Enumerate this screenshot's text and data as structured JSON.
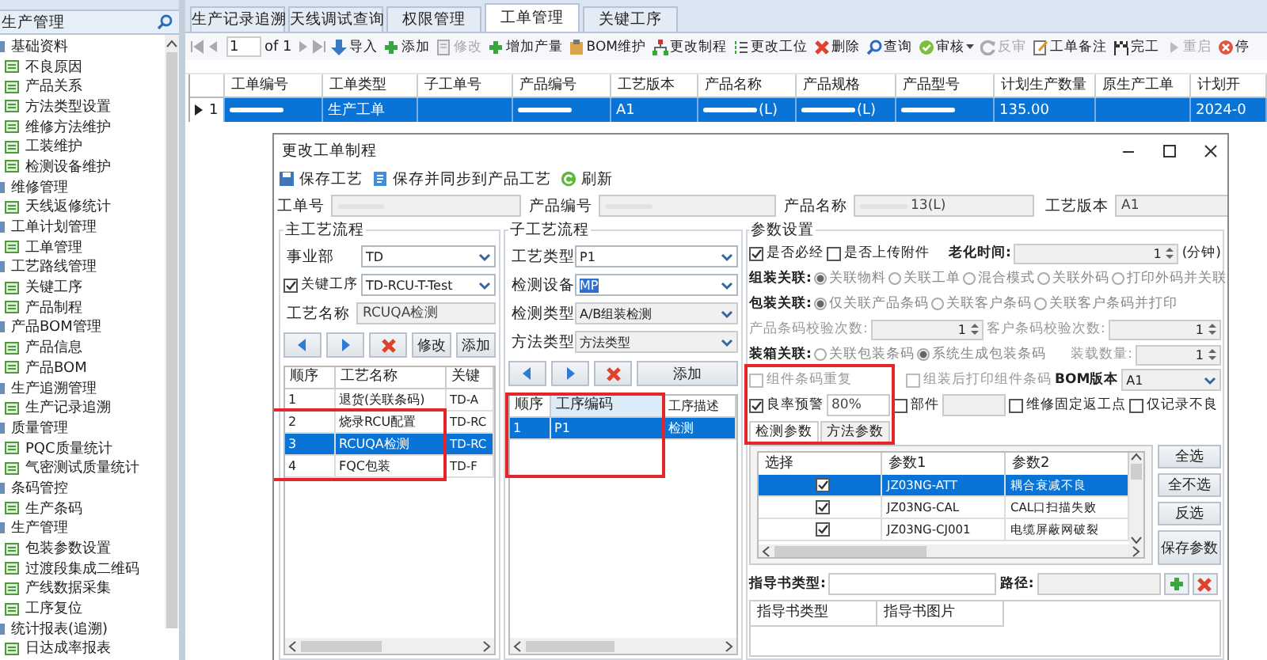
{
  "sidebar": {
    "title": "生产管理",
    "items": [
      {
        "label": "基础资料",
        "children": [
          {
            "label": "不良原因"
          },
          {
            "label": "产品关系"
          },
          {
            "label": "方法类型设置"
          },
          {
            "label": "维修方法维护"
          },
          {
            "label": "工装维护"
          },
          {
            "label": "检测设备维护"
          }
        ]
      },
      {
        "label": "维修管理",
        "children": [
          {
            "label": "天线返修统计"
          }
        ]
      },
      {
        "label": "工单计划管理",
        "children": [
          {
            "label": "工单管理"
          }
        ]
      },
      {
        "label": "工艺路线管理",
        "children": [
          {
            "label": "关键工序"
          },
          {
            "label": "产品制程"
          }
        ]
      },
      {
        "label": "产品BOM管理",
        "children": [
          {
            "label": "产品信息"
          },
          {
            "label": "产品BOM"
          }
        ]
      },
      {
        "label": "生产追溯管理",
        "children": [
          {
            "label": "生产记录追溯"
          }
        ]
      },
      {
        "label": "质量管理",
        "children": [
          {
            "label": "PQC质量统计"
          },
          {
            "label": "气密测试质量统计"
          }
        ]
      },
      {
        "label": "条码管控",
        "children": [
          {
            "label": "生产条码"
          }
        ]
      },
      {
        "label": "生产管理",
        "children": [
          {
            "label": "包装参数设置"
          },
          {
            "label": "过渡段集成二维码"
          },
          {
            "label": "产线数据采集"
          },
          {
            "label": "工序复位"
          }
        ]
      },
      {
        "label": "统计报表(追溯)",
        "children": [
          {
            "label": "日达成率报表"
          }
        ]
      }
    ]
  },
  "tabs": [
    {
      "label": "生产记录追溯",
      "selected": false
    },
    {
      "label": "天线调试查询",
      "selected": false
    },
    {
      "label": "权限管理",
      "selected": false
    },
    {
      "label": "工单管理",
      "selected": true
    },
    {
      "label": "关键工序",
      "selected": false
    }
  ],
  "pager": {
    "page": "1",
    "total": "of 1"
  },
  "toolbar": [
    {
      "label": "导入",
      "disabled": false
    },
    {
      "label": "添加",
      "disabled": false
    },
    {
      "label": "修改",
      "disabled": true
    },
    {
      "label": "增加产量",
      "disabled": false
    },
    {
      "label": "BOM维护",
      "disabled": false
    },
    {
      "label": "更改制程",
      "disabled": false
    },
    {
      "label": "更改工位",
      "disabled": false
    },
    {
      "label": "删除",
      "disabled": false
    },
    {
      "label": "查询",
      "disabled": false
    },
    {
      "label": "审核",
      "disabled": false
    },
    {
      "label": "反审",
      "disabled": true
    },
    {
      "label": "工单备注",
      "disabled": false
    },
    {
      "label": "完工",
      "disabled": false
    },
    {
      "label": "重启",
      "disabled": true
    },
    {
      "label": "停",
      "disabled": false
    }
  ],
  "grid": {
    "columns": [
      "工单编号",
      "工单类型",
      "子工单号",
      "产品编号",
      "工艺版本",
      "产品名称",
      "产品规格",
      "产品型号",
      "计划生产数量",
      "原生产工单",
      "计划开"
    ],
    "rows": [
      {
        "selected": true,
        "number": "1",
        "cells": [
          {
            "kind": "redacted"
          },
          {
            "kind": "text",
            "text": "生产工单"
          },
          {
            "kind": "empty"
          },
          {
            "kind": "redacted"
          },
          {
            "kind": "text",
            "text": "A1"
          },
          {
            "kind": "redacted",
            "text": "(L)"
          },
          {
            "kind": "redacted",
            "text": "(L)"
          },
          {
            "kind": "redacted"
          },
          {
            "kind": "text",
            "text": "135.00"
          },
          {
            "kind": "empty"
          },
          {
            "kind": "text",
            "text": "2024-0"
          }
        ]
      }
    ]
  },
  "dialog": {
    "title": "更改工单制程",
    "toolbar": [
      "保存工艺",
      "保存并同步到产品工艺",
      "刷新"
    ],
    "fields": [
      {
        "label": "工单号",
        "kind": "redacted"
      },
      {
        "label": "产品编号",
        "kind": "redacted"
      },
      {
        "label": "产品名称",
        "kind": "redacted",
        "value": "13(L)"
      },
      {
        "label": "工艺版本",
        "kind": "text",
        "value": "A1"
      }
    ],
    "main_process": {
      "title": "主工艺流程",
      "department": {
        "label": "事业部",
        "value": "TD"
      },
      "key_process": {
        "label": "关键工序",
        "checked": true,
        "value": "TD-RCU-T-Test"
      },
      "process_name": {
        "label": "工艺名称",
        "value": "RCUQA检测"
      },
      "buttons": [
        "修改",
        "添加"
      ],
      "columns": [
        "顺序",
        "工艺名称",
        "关键"
      ],
      "rows": [
        {
          "selected": false,
          "cells": [
            "1",
            "退货(关联条码)",
            "TD-A"
          ]
        },
        {
          "selected": false,
          "cells": [
            "2",
            "烧录RCU配置",
            "TD-RC"
          ]
        },
        {
          "selected": true,
          "cells": [
            "3",
            "RCUQA检测",
            "TD-RC"
          ]
        },
        {
          "selected": false,
          "cells": [
            "4",
            "FQC包装",
            "TD-F"
          ]
        }
      ]
    },
    "sub_process": {
      "title": "子工艺流程",
      "fields": [
        {
          "label": "工艺类型",
          "value": "P1",
          "disabled": false,
          "highlighted": false
        },
        {
          "label": "检测设备",
          "value": "MP",
          "disabled": false,
          "highlighted": true
        },
        {
          "label": "检测类型",
          "value": "A/B组装检测",
          "disabled": true,
          "highlighted": false
        },
        {
          "label": "方法类型",
          "value": "方法类型",
          "disabled": true,
          "highlighted": false
        }
      ],
      "buttons": [
        "添加"
      ],
      "columns": [
        "顺序",
        "工序编码",
        "工序描述"
      ],
      "rows": [
        {
          "selected": true,
          "cells": [
            "1",
            "P1",
            "检测"
          ]
        }
      ]
    },
    "params": {
      "title": "参数设置",
      "required": {
        "label": "是否必经",
        "checked": true
      },
      "upload": {
        "label": "是否上传附件",
        "checked": false
      },
      "aging": {
        "label": "老化时间:",
        "value": "1",
        "unit": "(分钟)"
      },
      "radio_groups": [
        {
          "label": "组装关联:",
          "options": [
            {
              "label": "关联物料",
              "selected": true
            },
            {
              "label": "关联工单",
              "selected": false
            },
            {
              "label": "混合模式",
              "selected": false
            },
            {
              "label": "关联外码",
              "selected": false
            },
            {
              "label": "打印外码并关联",
              "selected": false
            }
          ]
        },
        {
          "label": "包装关联:",
          "options": [
            {
              "label": "仅关联产品条码",
              "selected": true
            },
            {
              "label": "关联客户条码",
              "selected": false
            },
            {
              "label": "关联客户条码并打印",
              "selected": false
            }
          ]
        }
      ],
      "barcode_checks": [
        {
          "label": "产品条码校验次数:",
          "value": "1"
        },
        {
          "label": "客户条码校验次数:",
          "value": "1"
        }
      ],
      "packing": {
        "label": "装箱关联:",
        "options": [
          {
            "label": "关联包装条码",
            "selected": false
          },
          {
            "label": "系统生成包装条码",
            "selected": true
          }
        ],
        "quantity": {
          "label": "装载数量:",
          "value": "1"
        }
      },
      "component_options": [
        {
          "label": "组件条码重复",
          "checked": false
        },
        {
          "label": "组装后打印组件条码",
          "checked": false
        }
      ],
      "bom_version": {
        "label": "BOM版本",
        "value": "A1"
      },
      "yield_alert": {
        "label": "良率预警",
        "checked": true,
        "value": "80%"
      },
      "part": {
        "label": "部件",
        "checked": false
      },
      "extra_options": [
        {
          "label": "维修固定返工点",
          "checked": false
        },
        {
          "label": "仅记录不良",
          "checked": false
        }
      ],
      "tabs": [
        {
          "label": "检测参数",
          "selected": true
        },
        {
          "label": "方法参数",
          "selected": false
        }
      ],
      "columns": [
        "选择",
        "参数1",
        "参数2"
      ],
      "rows": [
        {
          "selected": true,
          "checked": true,
          "param1": "JZ03NG-ATT",
          "param2": "耦合衰减不良"
        },
        {
          "selected": false,
          "checked": true,
          "param1": "JZ03NG-CAL",
          "param2": "CAL口扫描失败"
        },
        {
          "selected": false,
          "checked": true,
          "param1": "JZ03NG-CJ001",
          "param2": "电缆屏蔽网破裂"
        }
      ],
      "buttons": [
        "全选",
        "全不选",
        "反选",
        "保存参数"
      ],
      "guide_type": {
        "label": "指导书类型:"
      },
      "path": {
        "label": "路径:"
      },
      "guide_columns": [
        "指导书类型",
        "指导书图片"
      ]
    }
  }
}
